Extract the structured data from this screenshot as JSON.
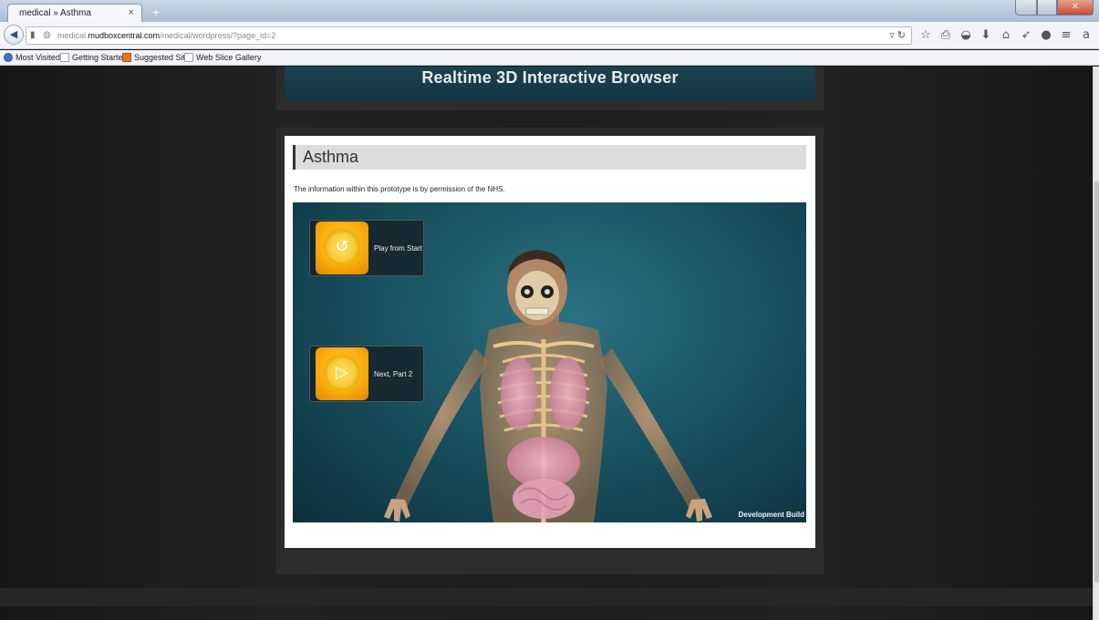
{
  "browser": {
    "tab_title": "medical » Asthma",
    "tab_close": "×",
    "new_tab": "+",
    "url_prefix": "medical.",
    "url_host": "mudboxcentral.com",
    "url_path": "/medical/wordpress/?page_id=2",
    "bookmarks": [
      "Most Visited",
      "Getting Started",
      "Suggested Sites",
      "Web Slice Gallery"
    ]
  },
  "page": {
    "banner_title": "Realtime 3D Interactive Browser",
    "post_title": "Asthma",
    "post_description": "The information within this prototype is by permission of the NHS.",
    "viewer": {
      "play_from_start_label": "Play from Start",
      "next_part_label": "Next, Part 2",
      "build_label": "Development Build"
    }
  }
}
